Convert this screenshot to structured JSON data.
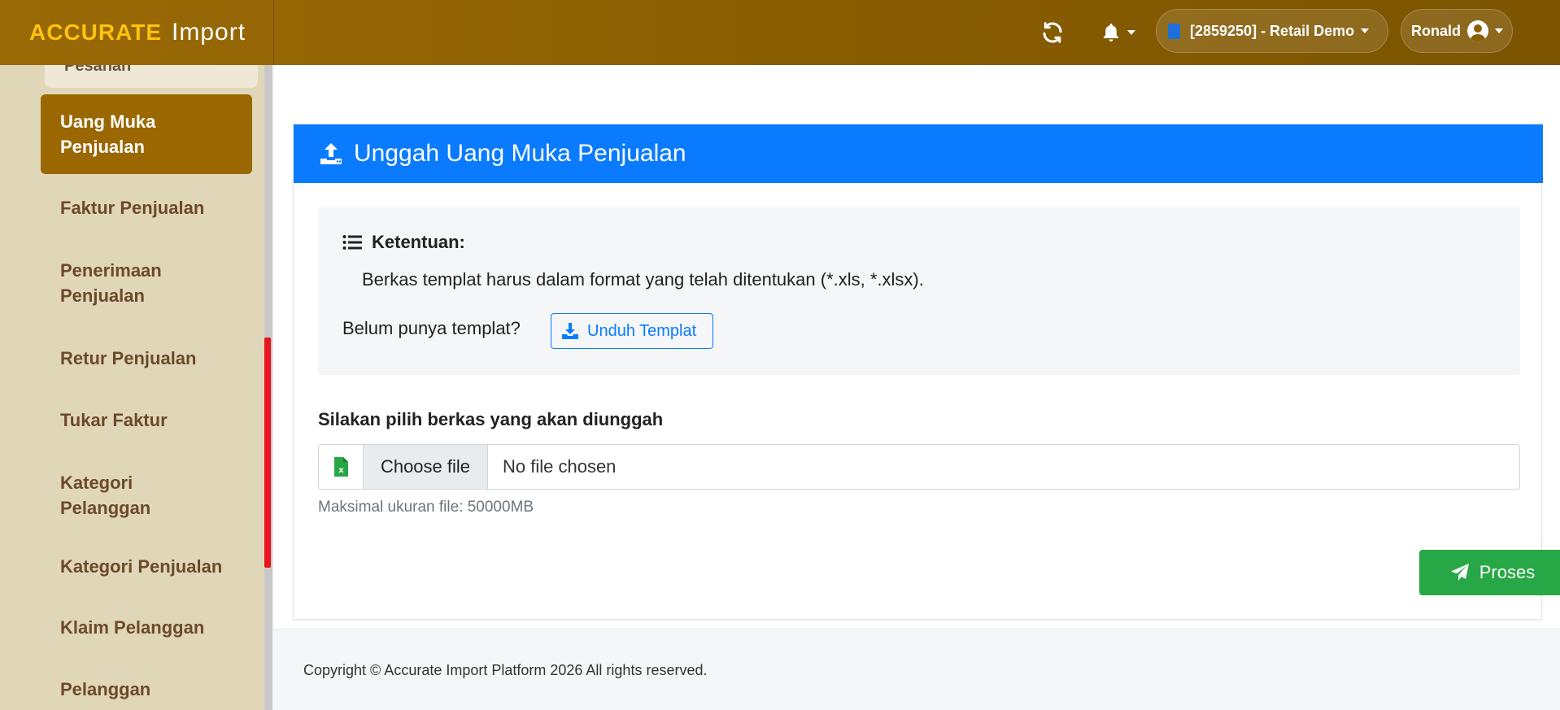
{
  "app": {
    "brand_primary": "ACCURATE",
    "brand_secondary": "Import",
    "company": "[2859250] - Retail Demo",
    "user": "Ronald"
  },
  "sidebar": {
    "prev_item": "Pesanan",
    "active_item": "Uang Muka Penjualan",
    "items": [
      "Faktur Penjualan",
      "Penerimaan Penjualan",
      "Retur Penjualan",
      "Tukar Faktur",
      "Kategori Pelanggan",
      "Kategori Penjualan",
      "Klaim Pelanggan",
      "Pelanggan"
    ]
  },
  "card": {
    "title": "Unggah Uang Muka Penjualan",
    "info_title": "Ketentuan:",
    "info_line": "Berkas templat harus dalam format yang telah ditentukan (*.xls, *.xlsx).",
    "template_question": "Belum punya templat?",
    "download_label": "Unduh Templat",
    "file_label": "Silakan pilih berkas yang akan diunggah",
    "choose_label": "Choose file",
    "no_file": "No file chosen",
    "hint": "Maksimal ukuran file: 50000MB",
    "submit_label": "Proses"
  },
  "footer": {
    "copyright": "Copyright © Accurate Import Platform 2026 All rights reserved."
  },
  "colors": {
    "header_gold": "#8a5e02",
    "brand_yellow": "#ffc20e",
    "sidebar_bg": "#e0d7b8",
    "active_item": "#9a6700",
    "primary_blue": "#0a7bff",
    "success_green": "#27a745"
  },
  "icons": {
    "refresh": "refresh-icon",
    "bell": "bell-icon",
    "company": "company-icon",
    "user": "user-circle-icon",
    "upload": "upload-icon",
    "list": "list-icon",
    "download": "download-icon",
    "excel": "excel-file-icon",
    "send": "paper-plane-icon"
  }
}
